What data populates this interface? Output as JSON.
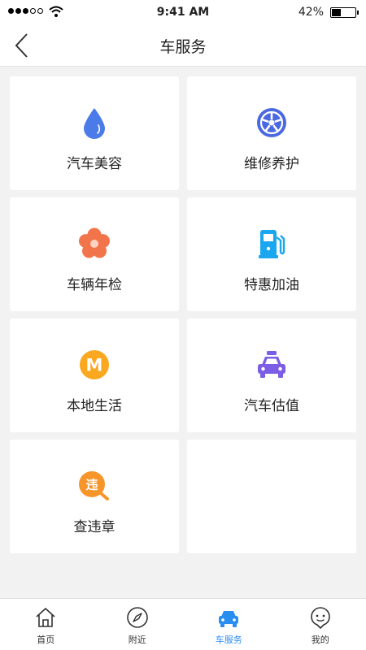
{
  "status_bar": {
    "time": "9:41 AM",
    "battery": "42%",
    "battery_level": 0.42
  },
  "header": {
    "title": "车服务"
  },
  "services": [
    {
      "label": "汽车美容",
      "icon": "water-drop-icon"
    },
    {
      "label": "维修养护",
      "icon": "wheel-icon"
    },
    {
      "label": "车辆年检",
      "icon": "flower-icon"
    },
    {
      "label": "特惠加油",
      "icon": "fuel-pump-icon"
    },
    {
      "label": "本地生活",
      "icon": "local-life-icon",
      "badge": "M"
    },
    {
      "label": "汽车估值",
      "icon": "taxi-icon"
    },
    {
      "label": "查违章",
      "icon": "violation-search-icon",
      "badge": "违"
    }
  ],
  "tabs": [
    {
      "label": "首页",
      "icon": "home-icon"
    },
    {
      "label": "附近",
      "icon": "compass-icon"
    },
    {
      "label": "车服务",
      "icon": "car-icon",
      "active": true
    },
    {
      "label": "我的",
      "icon": "profile-icon"
    }
  ],
  "colors": {
    "accent": "#2a8df0",
    "background": "#f2f2f2"
  }
}
